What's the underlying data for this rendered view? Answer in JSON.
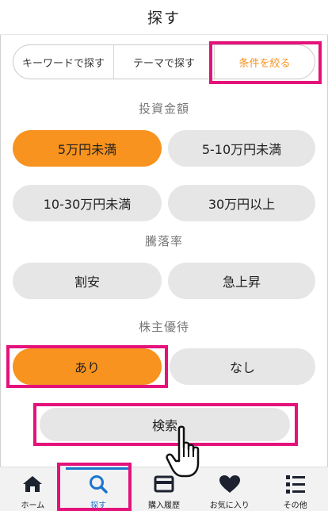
{
  "header": {
    "title": "探す"
  },
  "segments": [
    {
      "label": "キーワードで探す",
      "active": false
    },
    {
      "label": "テーマで探す",
      "active": false
    },
    {
      "label": "条件を絞る",
      "active": true
    }
  ],
  "sections": {
    "investment": {
      "title": "投資金額",
      "options": [
        "5万円未満",
        "5-10万円未満",
        "10-30万円未満",
        "30万円以上"
      ],
      "selected": "5万円未満"
    },
    "drop": {
      "title": "騰落率",
      "options": [
        "割安",
        "急上昇"
      ]
    },
    "benefit": {
      "title": "株主優待",
      "options": [
        "あり",
        "なし"
      ],
      "selected": "あり"
    }
  },
  "search_button": {
    "label": "検索"
  },
  "tabbar": {
    "items": [
      {
        "label": "ホーム",
        "icon": "home-icon"
      },
      {
        "label": "探す",
        "icon": "search-icon",
        "active": true
      },
      {
        "label": "購入履歴",
        "icon": "card-icon"
      },
      {
        "label": "お気に入り",
        "icon": "heart-icon"
      },
      {
        "label": "その他",
        "icon": "menu-icon"
      }
    ]
  },
  "colors": {
    "accent": "#f7931e",
    "highlight": "#e4127a",
    "active_tab": "#1a75ce",
    "pill_bg": "#e6e6e6"
  }
}
